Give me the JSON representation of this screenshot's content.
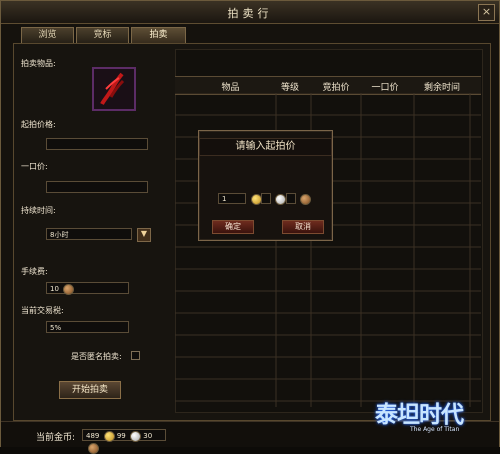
{
  "window": {
    "title": "拍卖行",
    "close_label": "×"
  },
  "tabs": [
    {
      "label": "浏览"
    },
    {
      "label": "竞标"
    },
    {
      "label": "拍卖"
    }
  ],
  "left_panel": {
    "item_label": "拍卖物品:",
    "start_price_label": "起拍价格:",
    "buyout_price_label": "一口价:",
    "duration_label": "持续时间:",
    "duration_value": "8小时",
    "fee_label": "手续费:",
    "fee_value": "10",
    "tax_label": "当前交易税:",
    "tax_value": "5%",
    "anonymous_label": "是否匿名拍卖:",
    "start_button": "开始拍卖"
  },
  "table": {
    "headers": [
      "物品",
      "等级",
      "竞拍价",
      "一口价",
      "剩余时间"
    ]
  },
  "modal": {
    "title": "请输入起拍价",
    "gold_value": "1",
    "silver_value": "",
    "copper_value": "",
    "confirm": "确定",
    "cancel": "取消"
  },
  "footer": {
    "currency_label": "当前金币:",
    "gold": "489",
    "silver": "99",
    "copper": "30"
  },
  "brand": {
    "logo": "泰坦时代",
    "tagline": "The Age of Titan"
  },
  "icons": {
    "dropdown": "chevron-down-icon",
    "close": "close-icon"
  },
  "colors": {
    "accent": "#8a6f48",
    "modal_button": "#6f2c1e",
    "item_border": "#5c2c66"
  }
}
